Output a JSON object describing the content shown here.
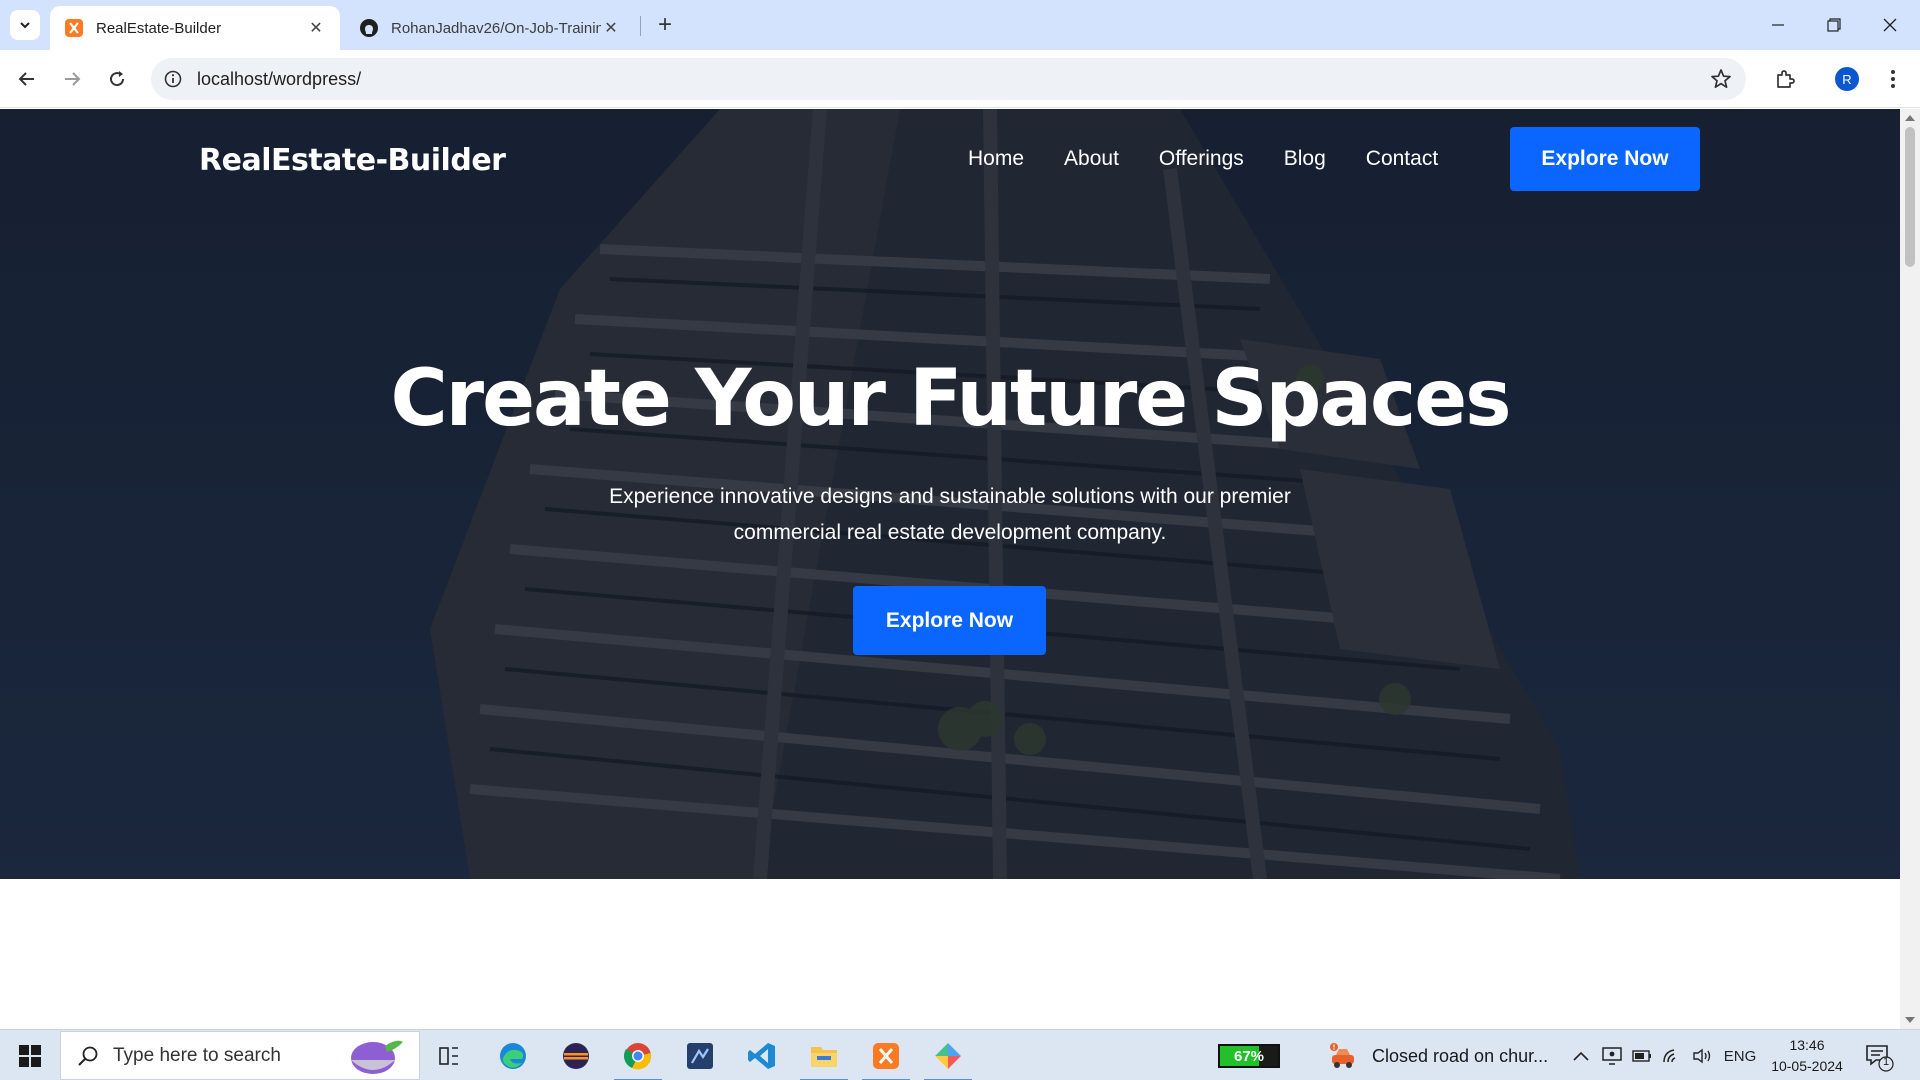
{
  "browser": {
    "tabs": [
      {
        "title": "RealEstate-Builder",
        "active": true,
        "icon": "xampp-icon"
      },
      {
        "title": "RohanJadhav26/On-Job-Trainin",
        "active": false,
        "icon": "github-icon"
      }
    ],
    "url": "localhost/wordpress/",
    "profile_initial": "R"
  },
  "site": {
    "logo": "RealEstate-Builder",
    "nav": [
      "Home",
      "About",
      "Offerings",
      "Blog",
      "Contact"
    ],
    "header_cta": "Explore Now",
    "hero": {
      "title": "Create Your Future Spaces",
      "subtitle_line1": "Experience innovative designs and sustainable solutions with our premier",
      "subtitle_line2": "commercial real estate development company.",
      "cta": "Explore Now"
    },
    "accent_color": "#0a66ff"
  },
  "taskbar": {
    "search_placeholder": "Type here to search",
    "battery_percent": "67%",
    "battery_level": 0.67,
    "news": "Closed road on chur...",
    "language": "ENG",
    "time": "13:46",
    "date": "10-05-2024",
    "notification_count": "1",
    "apps": [
      "task-view-icon",
      "edge-icon",
      "eclipse-icon",
      "chrome-icon",
      "devtool-icon",
      "vscode-icon",
      "file-explorer-icon",
      "xampp-icon",
      "app-icon"
    ]
  }
}
